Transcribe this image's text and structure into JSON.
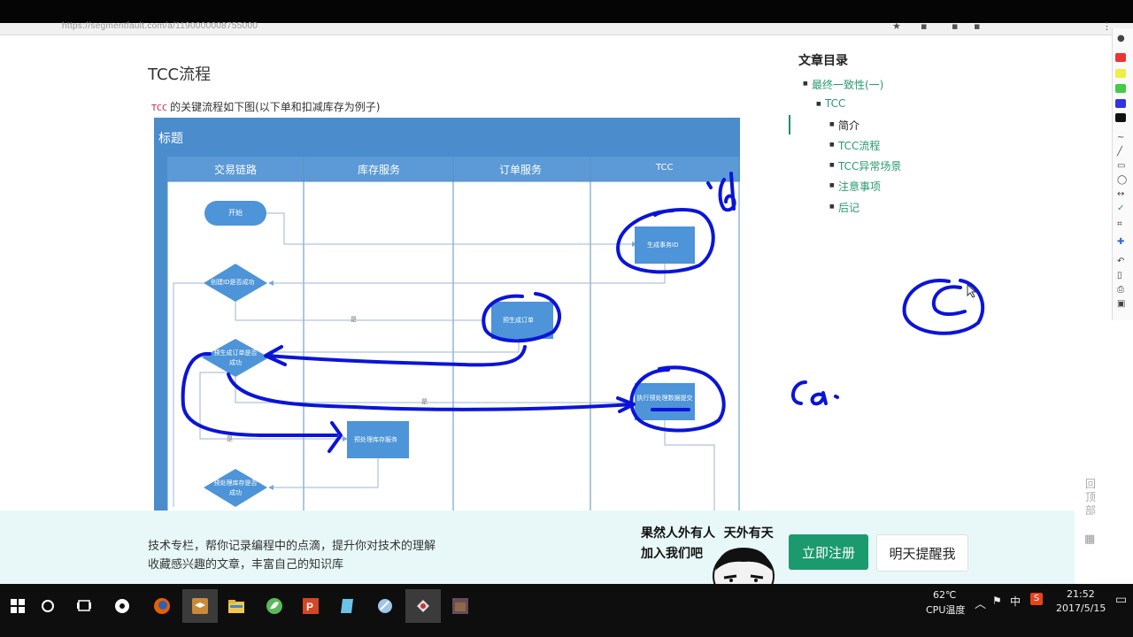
{
  "browser": {
    "url_text": "https://segmentfault.com/a/1190000008755000",
    "star_icon": "star-icon",
    "menu_icon": "menu-icon"
  },
  "article": {
    "section_title": "TCC流程",
    "intro_code": "TCC",
    "intro_text": "的关键流程如下图(以下单和扣减库存为例子)"
  },
  "diagram": {
    "title": "标题",
    "lanes": [
      "交易链路",
      "库存服务",
      "订单服务",
      "TCC"
    ],
    "nodes": {
      "start": "开始",
      "create_id_check": "创建ID是否成功",
      "gen_txn_id": "生成事务ID",
      "pre_order": "预生成订单",
      "pre_order_check": "预生成订单是否成功",
      "execute_pre": "执行预处理数据提交",
      "pre_stock": "预处理库存服务",
      "pre_stock_check": "预处理库存是否成功"
    },
    "edge_labels": {
      "yes1": "是",
      "yes2": "是",
      "yes3": "是"
    }
  },
  "toc": {
    "title": "文章目录",
    "items": [
      {
        "label": "最终一致性(一)",
        "level": 1
      },
      {
        "label": "TCC",
        "level": 2
      },
      {
        "label": "简介",
        "level": 3,
        "active": true
      },
      {
        "label": "TCC流程",
        "level": 3
      },
      {
        "label": "TCC异常场景",
        "level": 3
      },
      {
        "label": "注意事项",
        "level": 3
      },
      {
        "label": "后记",
        "level": 3
      }
    ]
  },
  "side_widgets": {
    "back_to_top": [
      "回",
      "顶",
      "部"
    ],
    "qr_icon": "qr-code-icon"
  },
  "banner": {
    "line1": "技术专栏，帮你记录编程中的点滴，提升你对技术的理解",
    "line2": "收藏感兴趣的文章，丰富自己的知识库",
    "promo_line1": "果然人外有人  天外有天",
    "promo_line2": "加入我们吧",
    "register_label": "立即注册",
    "remind_label": "明天提醒我"
  },
  "taskbar": {
    "temp": "62℃",
    "cpu_label": "CPU温度",
    "ime": "中",
    "time": "21:52",
    "date": "2017/5/15",
    "colors": {
      "active": "#3b3b3b"
    }
  },
  "colors": {
    "accent": "#1b9a6e",
    "diagram_blue": "#4a8ccc",
    "node_blue": "#4d94d8",
    "ink": "#0a14d8"
  }
}
